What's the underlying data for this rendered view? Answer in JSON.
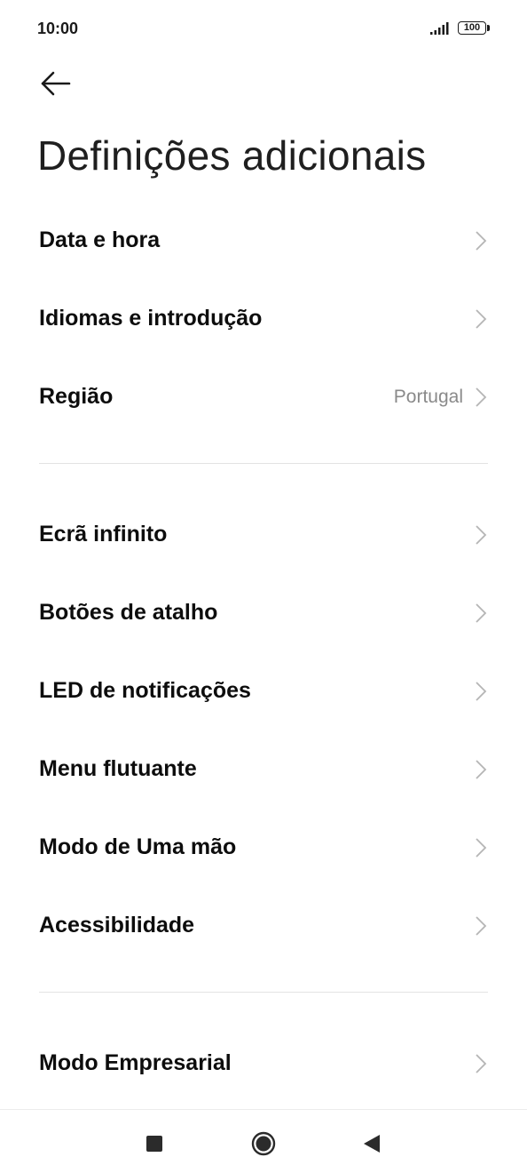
{
  "status_bar": {
    "time": "10:00",
    "battery_level": "100",
    "signal_icon": "signal-bars-icon",
    "battery_icon": "battery-icon"
  },
  "header": {
    "back_icon": "arrow-left-icon",
    "title": "Definições adicionais"
  },
  "sections": [
    {
      "items": [
        {
          "label": "Data e hora",
          "value": ""
        },
        {
          "label": "Idiomas e introdução",
          "value": ""
        },
        {
          "label": "Região",
          "value": "Portugal"
        }
      ]
    },
    {
      "items": [
        {
          "label": "Ecrã infinito",
          "value": ""
        },
        {
          "label": "Botões de atalho",
          "value": ""
        },
        {
          "label": "LED de notificações",
          "value": ""
        },
        {
          "label": "Menu flutuante",
          "value": ""
        },
        {
          "label": "Modo de Uma mão",
          "value": ""
        },
        {
          "label": "Acessibilidade",
          "value": ""
        }
      ]
    },
    {
      "items": [
        {
          "label": "Modo Empresarial",
          "value": ""
        }
      ]
    }
  ],
  "nav_bar": {
    "recents_icon": "square-icon",
    "home_icon": "circle-home-icon",
    "back_icon": "triangle-back-icon"
  },
  "colors": {
    "text_primary": "#0d0d0d",
    "text_secondary": "#8a8a8a",
    "chevron": "#b5b5b5",
    "divider": "#e3e3e3",
    "nav_icons": "#2b2b2b"
  }
}
